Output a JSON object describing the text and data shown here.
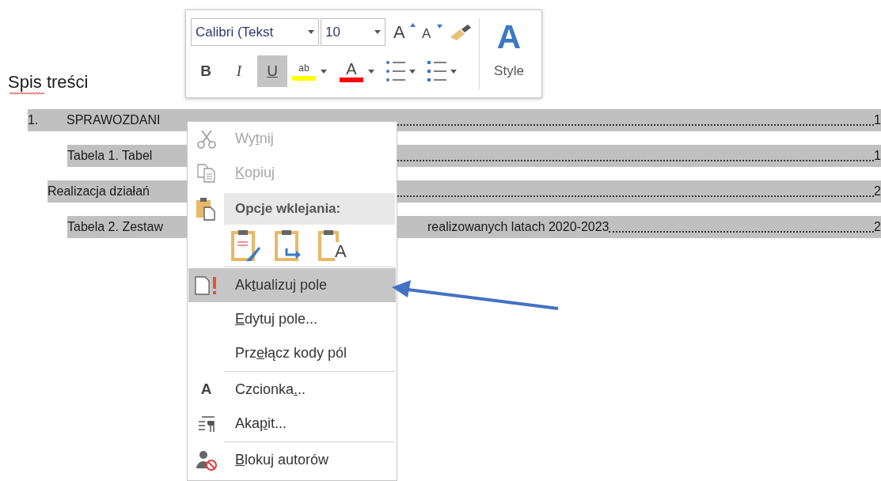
{
  "heading": "Spis treści",
  "toc": [
    {
      "kind": "chapter",
      "number": "1.",
      "text": "SPRAWOZDANI",
      "page": "1"
    },
    {
      "kind": "table",
      "text": "Tabela 1. Tabel",
      "page": "1"
    },
    {
      "kind": "section",
      "text": "Realizacja działań",
      "page": "2"
    },
    {
      "kind": "table",
      "text": "Tabela 2. Zestaw",
      "continued": "realizowanych latach 2020-2023",
      "page": "2"
    }
  ],
  "mini_toolbar": {
    "font": "Calibri (Tekst",
    "size": "10",
    "grow_glyph": "A",
    "shrink_glyph": "A",
    "styles_glyph": "A",
    "styles_label": "Style",
    "format_buttons": [
      {
        "label": "B",
        "selected": false
      },
      {
        "label": "I",
        "selected": false
      },
      {
        "label": "U",
        "selected": true
      }
    ],
    "highlight_glyph": "ab",
    "font_color_glyph": "A"
  },
  "context_menu": [
    {
      "kind": "item",
      "label": {
        "before": "Wy",
        "key": "t",
        "after": "nij"
      },
      "disabled": true,
      "selected": false
    },
    {
      "kind": "item",
      "label": {
        "key": "K",
        "after": "opiuj"
      },
      "disabled": true,
      "selected": false
    },
    {
      "kind": "header",
      "label": "Opcje wklejania:"
    },
    {
      "kind": "paste_options",
      "options": [
        {
          "kind": "icon"
        },
        {
          "kind": "icon"
        },
        {
          "kind": "glyph",
          "glyph": "A"
        }
      ]
    },
    {
      "kind": "separator"
    },
    {
      "kind": "item",
      "label": {
        "before": "Ak",
        "key": "t",
        "after": "ualizuj pole"
      },
      "disabled": false,
      "selected": true
    },
    {
      "kind": "item",
      "label": {
        "key": "E",
        "after": "dytuj pole..."
      },
      "disabled": false,
      "selected": false
    },
    {
      "kind": "item",
      "label": {
        "before": "Prz",
        "key": "e",
        "after": "łącz kody pól"
      },
      "disabled": false,
      "selected": false
    },
    {
      "kind": "separator"
    },
    {
      "kind": "item",
      "glyph": "A",
      "label": {
        "before": "Czcionka",
        "key": ".",
        "after": ".."
      },
      "disabled": false,
      "selected": false
    },
    {
      "kind": "item",
      "label": {
        "before": "Aka",
        "key": "p",
        "after": "it..."
      },
      "disabled": false,
      "selected": false
    },
    {
      "kind": "separator"
    },
    {
      "kind": "item",
      "label": {
        "key": "B",
        "after": "lokuj autorów"
      },
      "disabled": false,
      "selected": false
    }
  ]
}
